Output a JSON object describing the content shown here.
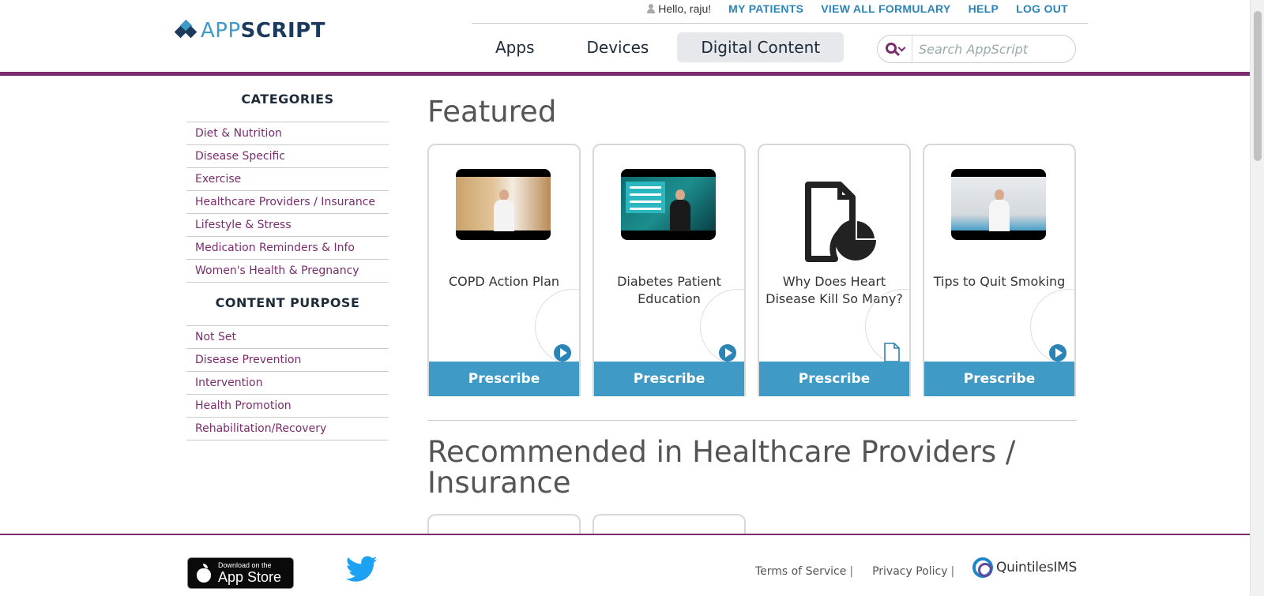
{
  "logo": {
    "app": "APP",
    "script": "SCRIPT"
  },
  "topbar": {
    "greeting": "Hello, raju!",
    "links": [
      "MY PATIENTS",
      "VIEW ALL FORMULARY",
      "HELP",
      "LOG OUT"
    ]
  },
  "nav": {
    "items": [
      "Apps",
      "Devices",
      "Digital Content"
    ],
    "active": "Digital Content"
  },
  "search": {
    "placeholder": "Search AppScript"
  },
  "sidebar": {
    "categories_heading": "CATEGORIES",
    "categories": [
      "Diet & Nutrition",
      "Disease Specific",
      "Exercise",
      "Healthcare Providers / Insurance",
      "Lifestyle & Stress",
      "Medication Reminders & Info",
      "Women's Health & Pregnancy"
    ],
    "purpose_heading": "CONTENT PURPOSE",
    "purposes": [
      "Not Set",
      "Disease Prevention",
      "Intervention",
      "Health Promotion",
      "Rehabilitation/Recovery"
    ]
  },
  "main": {
    "featured_title": "Featured",
    "cards": [
      {
        "title": "COPD Action Plan",
        "type": "video",
        "button": "Prescribe"
      },
      {
        "title": "Diabetes Patient Education",
        "type": "video",
        "button": "Prescribe"
      },
      {
        "title": "Why Does Heart Disease Kill So Many?",
        "type": "document",
        "button": "Prescribe"
      },
      {
        "title": "Tips to Quit Smoking",
        "type": "video",
        "button": "Prescribe"
      }
    ],
    "recommended_title": "Recommended in Healthcare Providers / Insurance"
  },
  "footer": {
    "appstore_small": "Download on the",
    "appstore_big": "App Store",
    "terms": "Terms of Service",
    "privacy": "Privacy Policy",
    "separator": "|",
    "brand": "QuintilesIMS"
  },
  "colors": {
    "brand_purple": "#7a2c6e",
    "accent_blue": "#3f9ac6",
    "link_blue": "#2a84b6"
  }
}
